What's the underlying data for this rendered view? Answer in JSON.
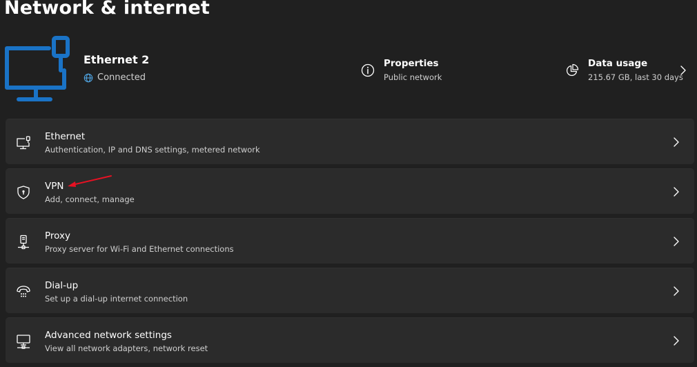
{
  "page": {
    "title": "Network & internet"
  },
  "connection": {
    "name": "Ethernet 2",
    "status": "Connected",
    "icon": "ethernet-pc-icon",
    "status_icon": "globe-icon"
  },
  "properties": {
    "title": "Properties",
    "subtitle": "Public network",
    "icon": "info-icon"
  },
  "data_usage": {
    "title": "Data usage",
    "subtitle": "215.67 GB, last 30 days",
    "icon": "pie-chart-icon"
  },
  "items": [
    {
      "id": "ethernet",
      "title": "Ethernet",
      "subtitle": "Authentication, IP and DNS settings, metered network",
      "icon": "ethernet-icon"
    },
    {
      "id": "vpn",
      "title": "VPN",
      "subtitle": "Add, connect, manage",
      "icon": "shield-icon"
    },
    {
      "id": "proxy",
      "title": "Proxy",
      "subtitle": "Proxy server for Wi-Fi and Ethernet connections",
      "icon": "proxy-icon"
    },
    {
      "id": "dialup",
      "title": "Dial-up",
      "subtitle": "Set up a dial-up internet connection",
      "icon": "phone-icon"
    },
    {
      "id": "advanced",
      "title": "Advanced network settings",
      "subtitle": "View all network adapters, network reset",
      "icon": "monitor-network-icon"
    }
  ],
  "colors": {
    "background": "#202020",
    "card": "#2b2b2b",
    "accent": "#0078d4",
    "annotation": "#e81123"
  }
}
